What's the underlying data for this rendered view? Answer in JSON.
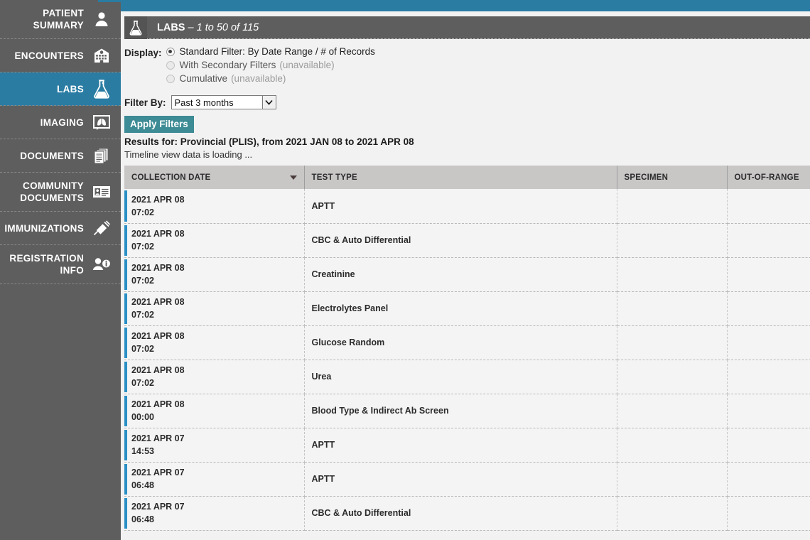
{
  "topbar": {
    "cut_off_text": ""
  },
  "sidebar": {
    "items": [
      {
        "label": "PATIENT SUMMARY",
        "icon": "person-icon",
        "active": false,
        "two_line": true
      },
      {
        "label": "ENCOUNTERS",
        "icon": "hospital-icon",
        "active": false,
        "two_line": false
      },
      {
        "label": "LABS",
        "icon": "flask-icon",
        "active": true,
        "two_line": false
      },
      {
        "label": "IMAGING",
        "icon": "xray-lungs-icon",
        "active": false,
        "two_line": false
      },
      {
        "label": "DOCUMENTS",
        "icon": "documents-icon",
        "active": false,
        "two_line": false
      },
      {
        "label": "COMMUNITY DOCUMENTS",
        "icon": "id-card-icon",
        "active": false,
        "two_line": true
      },
      {
        "label": "IMMUNIZATIONS",
        "icon": "syringe-icon",
        "active": false,
        "two_line": false
      },
      {
        "label": "REGISTRATION INFO",
        "icon": "person-info-icon",
        "active": false,
        "two_line": true
      }
    ]
  },
  "panel": {
    "icon": "flask-icon",
    "title": "LABS",
    "range": "– 1 to 50 of 115"
  },
  "filters": {
    "display_label": "Display:",
    "options": [
      {
        "label": "Standard Filter: By Date Range / # of Records",
        "note": "",
        "selected": true,
        "disabled": false
      },
      {
        "label": "With Secondary Filters",
        "note": "(unavailable)",
        "selected": false,
        "disabled": true
      },
      {
        "label": "Cumulative",
        "note": "(unavailable)",
        "selected": false,
        "disabled": true
      }
    ],
    "filter_by_label": "Filter By:",
    "filter_by_value": "Past 3 months",
    "filter_by_options": [
      "Past 3 months"
    ],
    "apply_label": "Apply Filters",
    "results_line": "Results for: Provincial (PLIS), from 2021 JAN 08 to 2021 APR 08",
    "loading_line": "Timeline view data is loading ..."
  },
  "table": {
    "columns": [
      "COLLECTION DATE",
      "TEST TYPE",
      "SPECIMEN",
      "OUT-OF-RANGE"
    ],
    "sort_column": "COLLECTION DATE",
    "sort_direction": "descending",
    "rows": [
      {
        "date": "2021 APR 08",
        "time": "07:02",
        "test": "APTT",
        "specimen": "",
        "out_of_range": true
      },
      {
        "date": "2021 APR 08",
        "time": "07:02",
        "test": "CBC & Auto Differential",
        "specimen": "",
        "out_of_range": true
      },
      {
        "date": "2021 APR 08",
        "time": "07:02",
        "test": "Creatinine",
        "specimen": "",
        "out_of_range": true
      },
      {
        "date": "2021 APR 08",
        "time": "07:02",
        "test": "Electrolytes Panel",
        "specimen": "",
        "out_of_range": true
      },
      {
        "date": "2021 APR 08",
        "time": "07:02",
        "test": "Glucose Random",
        "specimen": "",
        "out_of_range": false
      },
      {
        "date": "2021 APR 08",
        "time": "07:02",
        "test": "Urea",
        "specimen": "",
        "out_of_range": true
      },
      {
        "date": "2021 APR 08",
        "time": "00:00",
        "test": "Blood Type & Indirect Ab Screen",
        "specimen": "",
        "out_of_range": false
      },
      {
        "date": "2021 APR 07",
        "time": "14:53",
        "test": "APTT",
        "specimen": "",
        "out_of_range": true
      },
      {
        "date": "2021 APR 07",
        "time": "06:48",
        "test": "APTT",
        "specimen": "",
        "out_of_range": true
      },
      {
        "date": "2021 APR 07",
        "time": "06:48",
        "test": "CBC & Auto Differential",
        "specimen": "",
        "out_of_range": true
      }
    ],
    "out_of_range_symbol": "!"
  },
  "colors": {
    "accent_teal": "#2a7ca3",
    "button_teal": "#3d8b95",
    "sidebar_grey": "#5e5e5e",
    "header_grey": "#c9c6c6",
    "row_accent_blue": "#2a8fc4",
    "alert_red": "#e8615f"
  }
}
